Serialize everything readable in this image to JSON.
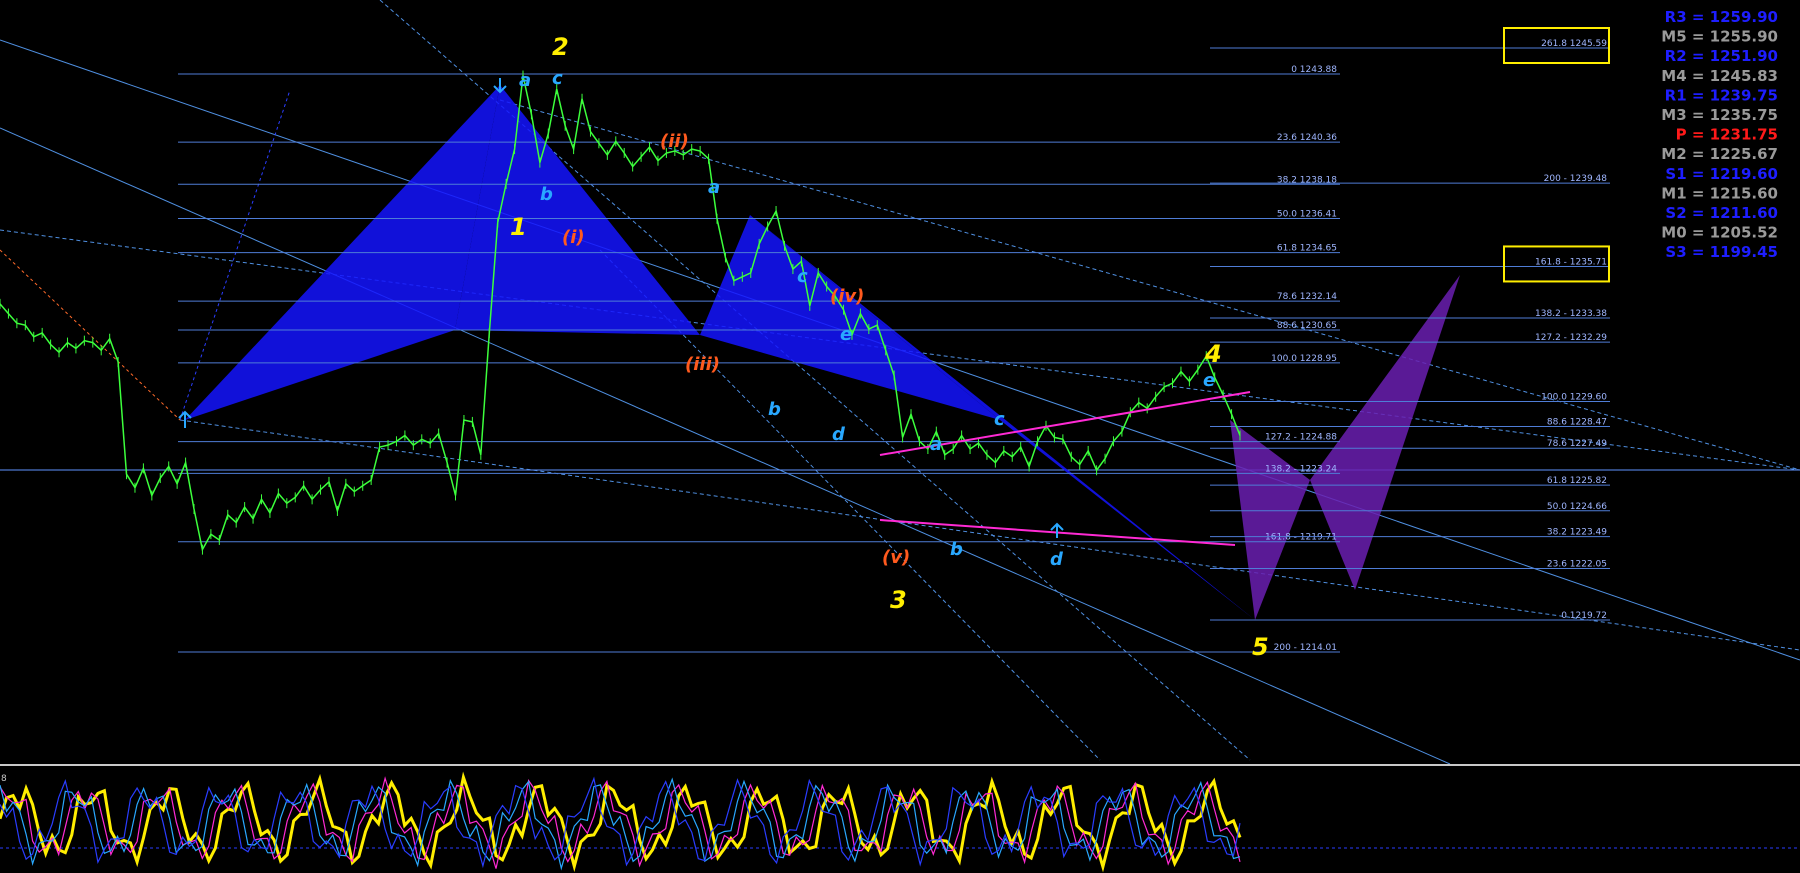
{
  "chart_data": {
    "type": "line",
    "symbol_context": "price chart with Elliott wave count, Fibonacci levels and daily pivots",
    "ylim": [
      1213.0,
      1262.0
    ],
    "price_series": {
      "name": "",
      "values": [
        1232.0,
        1231.5,
        1231.0,
        1230.9,
        1230.3,
        1230.5,
        1229.9,
        1229.5,
        1230.0,
        1229.7,
        1230.1,
        1230.0,
        1229.6,
        1230.2,
        1229.0,
        1223.2,
        1222.5,
        1223.5,
        1222.1,
        1223.0,
        1223.6,
        1222.7,
        1223.8,
        1221.4,
        1219.3,
        1220.1,
        1219.8,
        1221.1,
        1220.7,
        1221.5,
        1220.9,
        1221.9,
        1221.2,
        1222.2,
        1221.7,
        1222.0,
        1222.6,
        1221.9,
        1222.4,
        1222.8,
        1221.3,
        1222.7,
        1222.3,
        1222.6,
        1222.9,
        1224.6,
        1224.7,
        1224.9,
        1225.2,
        1224.7,
        1225.0,
        1224.8,
        1225.3,
        1223.8,
        1222.1,
        1226.0,
        1225.9,
        1224.2,
        1230.5,
        1236.2,
        1238.2,
        1240.0,
        1243.8,
        1241.8,
        1239.3,
        1240.8,
        1243.1,
        1241.2,
        1240.0,
        1242.6,
        1240.9,
        1240.3,
        1239.7,
        1240.4,
        1239.8,
        1239.1,
        1239.6,
        1240.1,
        1239.4,
        1239.8,
        1239.9,
        1239.7,
        1240.0,
        1239.9,
        1239.5,
        1236.4,
        1234.4,
        1233.2,
        1233.4,
        1233.6,
        1235.1,
        1236.0,
        1236.8,
        1235.0,
        1233.8,
        1234.2,
        1231.9,
        1233.6,
        1232.9,
        1232.4,
        1231.7,
        1230.4,
        1231.5,
        1230.7,
        1230.9,
        1229.6,
        1228.3,
        1225.1,
        1226.3,
        1224.9,
        1224.5,
        1225.4,
        1224.2,
        1224.5,
        1225.2,
        1224.5,
        1224.8,
        1224.2,
        1223.8,
        1224.4,
        1224.1,
        1224.6,
        1223.6,
        1224.9,
        1225.7,
        1225.1,
        1225.0,
        1224.1,
        1223.7,
        1224.4,
        1223.4,
        1224.0,
        1224.9,
        1225.4,
        1226.4,
        1226.9,
        1226.6,
        1227.2,
        1227.7,
        1227.9,
        1228.5,
        1228.0,
        1228.6,
        1229.3,
        1228.2,
        1227.3,
        1226.3,
        1225.2
      ]
    },
    "fib_levels_left": [
      {
        "label": "0 1243.88",
        "value": 1243.88
      },
      {
        "label": "23.6 1240.36",
        "value": 1240.36
      },
      {
        "label": "38.2 1238.18",
        "value": 1238.18
      },
      {
        "label": "50.0 1236.41",
        "value": 1236.41
      },
      {
        "label": "61.8 1234.65",
        "value": 1234.65
      },
      {
        "label": "78.6 1232.14",
        "value": 1232.14
      },
      {
        "label": "88.6 1230.65",
        "value": 1230.65
      },
      {
        "label": "100.0 1228.95",
        "value": 1228.95
      },
      {
        "label": "127.2 - 1224.88",
        "value": 1224.88
      },
      {
        "label": "138.2 - 1223.24",
        "value": 1223.24
      },
      {
        "label": "161.8 - 1219.71",
        "value": 1219.71
      },
      {
        "label": "200 - 1214.01",
        "value": 1214.01
      }
    ],
    "fib_levels_right": [
      {
        "label": "261.8 1245.59",
        "value": 1245.59,
        "boxed": true
      },
      {
        "label": "200 - 1239.48",
        "value": 1239.48
      },
      {
        "label": "161.8 - 1235.71",
        "value": 1235.71,
        "boxed": true
      },
      {
        "label": "138.2 - 1233.38",
        "value": 1233.38
      },
      {
        "label": "127.2 - 1232.29",
        "value": 1232.29
      },
      {
        "label": "100.0 1229.60",
        "value": 1229.6
      },
      {
        "label": "88.6 1228.47",
        "value": 1228.47
      },
      {
        "label": "78.6 1227.49",
        "value": 1227.49
      },
      {
        "label": "61.8 1225.82",
        "value": 1225.82
      },
      {
        "label": "50.0 1224.66",
        "value": 1224.66
      },
      {
        "label": "38.2 1223.49",
        "value": 1223.49
      },
      {
        "label": "23.6 1222.05",
        "value": 1222.05
      },
      {
        "label": "0 1219.72",
        "value": 1219.72
      }
    ],
    "wave_labels": {
      "major": [
        "1",
        "2",
        "3",
        "4",
        "5"
      ],
      "sub_orange": [
        "(i)",
        "(ii)",
        "(iii)",
        "(iv)",
        "(v)"
      ],
      "sub_blue": [
        "a",
        "c",
        "b",
        "a",
        "c",
        "e",
        "b",
        "d",
        "a",
        "c",
        "b",
        "d",
        "e"
      ]
    },
    "pivots": [
      {
        "label": "R3 = 1259.90",
        "color": "#1e1eff"
      },
      {
        "label": "M5 = 1255.90",
        "color": "#9a9a9a"
      },
      {
        "label": "R2 = 1251.90",
        "color": "#1e1eff"
      },
      {
        "label": "M4 = 1245.83",
        "color": "#9a9a9a"
      },
      {
        "label": "R1 = 1239.75",
        "color": "#1e1eff"
      },
      {
        "label": "M3 = 1235.75",
        "color": "#9a9a9a"
      },
      {
        "label": "P   = 1231.75",
        "color": "#ff1a1a"
      },
      {
        "label": "M2 = 1225.67",
        "color": "#9a9a9a"
      },
      {
        "label": "S1 = 1219.60",
        "color": "#1e1eff"
      },
      {
        "label": "M1 = 1215.60",
        "color": "#9a9a9a"
      },
      {
        "label": "S2 = 1211.60",
        "color": "#1e1eff"
      },
      {
        "label": "M0 = 1205.52",
        "color": "#9a9a9a"
      },
      {
        "label": "S3 = 1199.45",
        "color": "#1e1eff"
      }
    ],
    "oscillator": {
      "label": "8",
      "lines": [
        "#ffee00",
        "#ff2ad4",
        "#29a8ff",
        "#2a3dff"
      ]
    },
    "colors": {
      "candles": "#3cff3c",
      "pattern_blue": "#1414ff",
      "pattern_purple": "#6a1fb0",
      "trend_magenta": "#ff2ad4",
      "fib_line": "#4f7dd6",
      "box": "#ffee00"
    }
  }
}
